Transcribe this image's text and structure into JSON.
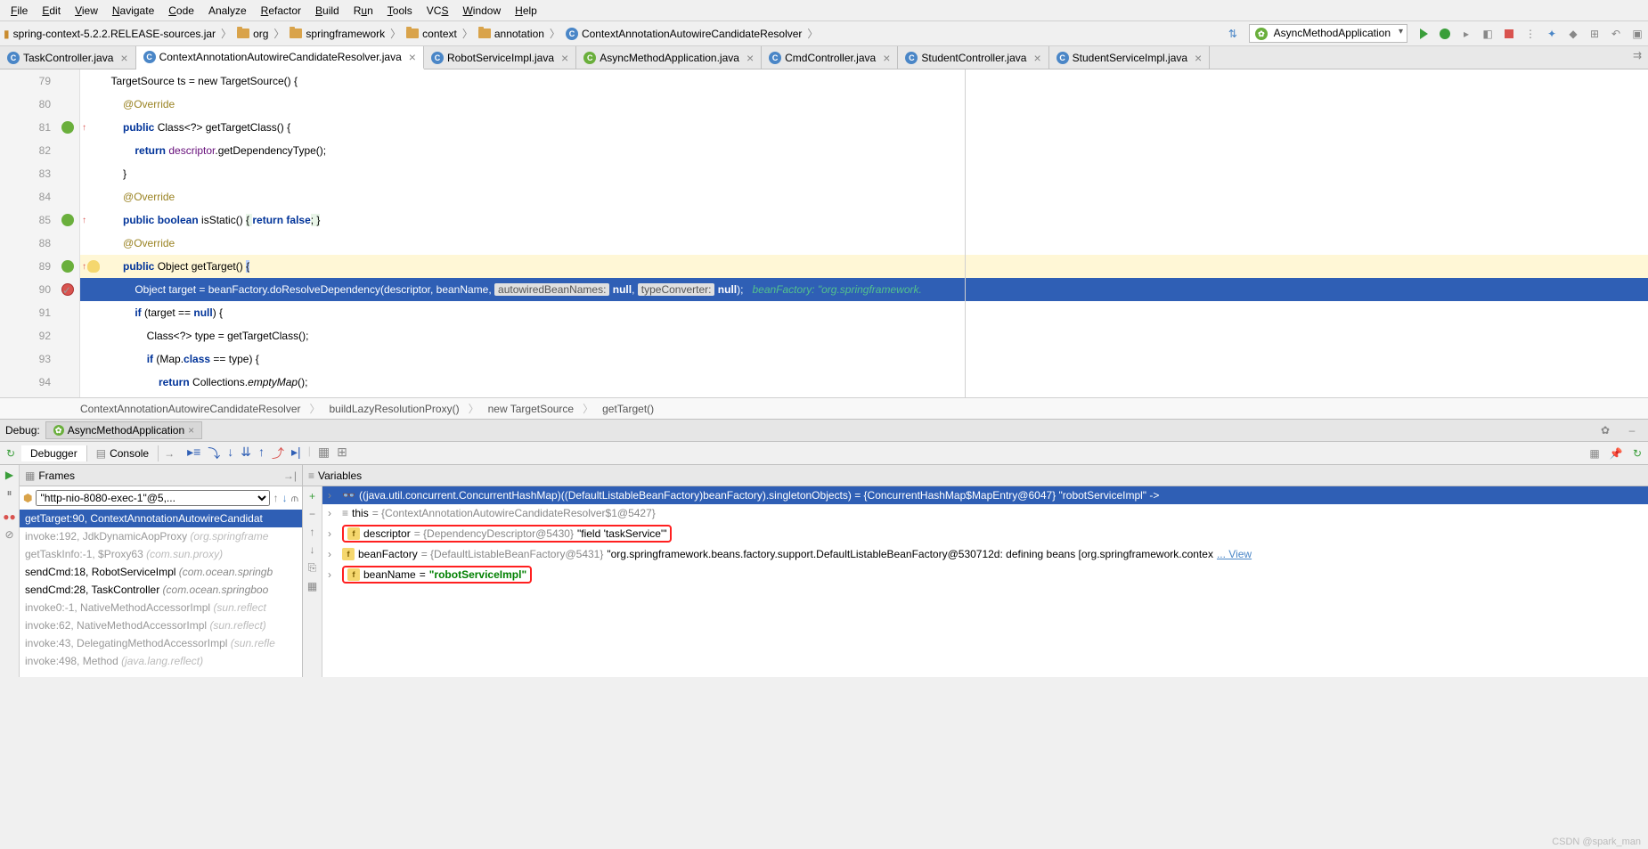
{
  "menu": [
    "File",
    "Edit",
    "View",
    "Navigate",
    "Code",
    "Analyze",
    "Refactor",
    "Build",
    "Run",
    "Tools",
    "VCS",
    "Window",
    "Help"
  ],
  "breadcrumbs": {
    "jar": "spring-context-5.2.2.RELEASE-sources.jar",
    "items": [
      "org",
      "springframework",
      "context",
      "annotation"
    ],
    "class": "ContextAnnotationAutowireCandidateResolver"
  },
  "run_config": "AsyncMethodApplication",
  "tabs": [
    {
      "name": "TaskController.java",
      "active": false
    },
    {
      "name": "ContextAnnotationAutowireCandidateResolver.java",
      "active": true
    },
    {
      "name": "RobotServiceImpl.java",
      "active": false
    },
    {
      "name": "AsyncMethodApplication.java",
      "active": false
    },
    {
      "name": "CmdController.java",
      "active": false
    },
    {
      "name": "StudentController.java",
      "active": false
    },
    {
      "name": "StudentServiceImpl.java",
      "active": false
    }
  ],
  "lines": {
    "n79": "79",
    "n80": "80",
    "n81": "81",
    "n82": "82",
    "n83": "83",
    "n84": "84",
    "n85": "85",
    "n88": "88",
    "n89": "89",
    "n90": "90",
    "n91": "91",
    "n92": "92",
    "n93": "93",
    "n94": "94"
  },
  "code": {
    "l79": "        TargetSource ts = new TargetSource() {",
    "l80_ann": "@Override",
    "l81_pub": "public",
    "l81_cls": " Class<?> getTargetClass() {",
    "l82_ret": "return",
    "l82_desc": " descriptor",
    "l82_rest": ".getDependencyType();",
    "l83": "            }",
    "l84_ann": "@Override",
    "l85_pub": "public ",
    "l85_bool": "boolean",
    "l85_name": " isStatic() ",
    "l85_brace": "{ ",
    "l85_ret": "return ",
    "l85_false": "false",
    "l85_end": "; }",
    "l88_ann": "@Override",
    "l89_pub": "public",
    "l89_obj": " Object getTarget() ",
    "l89_brace": "{",
    "l90_a": "                Object target = beanFactory.doResolveDependency(descriptor, beanName, ",
    "l90_h1": "autowiredBeanNames:",
    "l90_n1": " null",
    "l90_c": ", ",
    "l90_h2": "typeConverter:",
    "l90_n2": " null",
    "l90_end": ");   ",
    "l90_comm": "beanFactory: \"org.springframework.",
    "l91_if": "if",
    "l91_rest": " (target == ",
    "l91_null": "null",
    "l91_end": ") {",
    "l92": "                    Class<?> type = getTargetClass();",
    "l93_if": "if",
    "l93_a": " (Map.",
    "l93_cls": "class",
    "l93_b": " == type) {",
    "l94_ret": "return",
    "l94_a": " Collections.",
    "l94_em": "emptyMap",
    "l94_end": "();"
  },
  "code_bc": [
    "ContextAnnotationAutowireCandidateResolver",
    "buildLazyResolutionProxy()",
    "new TargetSource",
    "getTarget()"
  ],
  "debug": {
    "title": "Debug:",
    "session": "AsyncMethodApplication",
    "tabs": {
      "debugger": "Debugger",
      "console": "Console"
    },
    "frames_title": "Frames",
    "vars_title": "Variables",
    "thread": "\"http-nio-8080-exec-1\"@5,...",
    "frames": [
      {
        "txt": "getTarget:90, ContextAnnotationAutowireCandidat",
        "sel": true,
        "lib": false
      },
      {
        "txt": "invoke:192, JdkDynamicAopProxy ",
        "pkg": "(org.springframe",
        "lib": true
      },
      {
        "txt": "getTaskInfo:-1, $Proxy63 ",
        "pkg": "(com.sun.proxy)",
        "lib": true
      },
      {
        "txt": "sendCmd:18, RobotServiceImpl ",
        "pkg": "(com.ocean.springb",
        "lib": false
      },
      {
        "txt": "sendCmd:28, TaskController ",
        "pkg": "(com.ocean.springboo",
        "lib": false
      },
      {
        "txt": "invoke0:-1, NativeMethodAccessorImpl ",
        "pkg": "(sun.reflect",
        "lib": true
      },
      {
        "txt": "invoke:62, NativeMethodAccessorImpl ",
        "pkg": "(sun.reflect)",
        "lib": true
      },
      {
        "txt": "invoke:43, DelegatingMethodAccessorImpl ",
        "pkg": "(sun.refle",
        "lib": true
      },
      {
        "txt": "invoke:498, Method ",
        "pkg": "(java.lang.reflect)",
        "lib": true
      }
    ],
    "eval": "((java.util.concurrent.ConcurrentHashMap)((DefaultListableBeanFactory)beanFactory).singletonObjects) = {ConcurrentHashMap$MapEntry@6047} \"robotServiceImpl\" ->",
    "vars": {
      "this_name": "this",
      "this_type": " = {ContextAnnotationAutowireCandidateResolver$1@5427}",
      "desc_name": "descriptor",
      "desc_type": " = {DependencyDescriptor@5430}",
      "desc_val": " \"field 'taskService'\"",
      "bf_name": "beanFactory",
      "bf_type": " = {DefaultListableBeanFactory@5431}",
      "bf_val": " \"org.springframework.beans.factory.support.DefaultListableBeanFactory@530712d: defining beans [org.springframework.contex",
      "bf_view": "... View",
      "bn_name": "beanName",
      "bn_eq": " = ",
      "bn_val": "\"robotServiceImpl\""
    }
  },
  "watermark": "CSDN @spark_man"
}
